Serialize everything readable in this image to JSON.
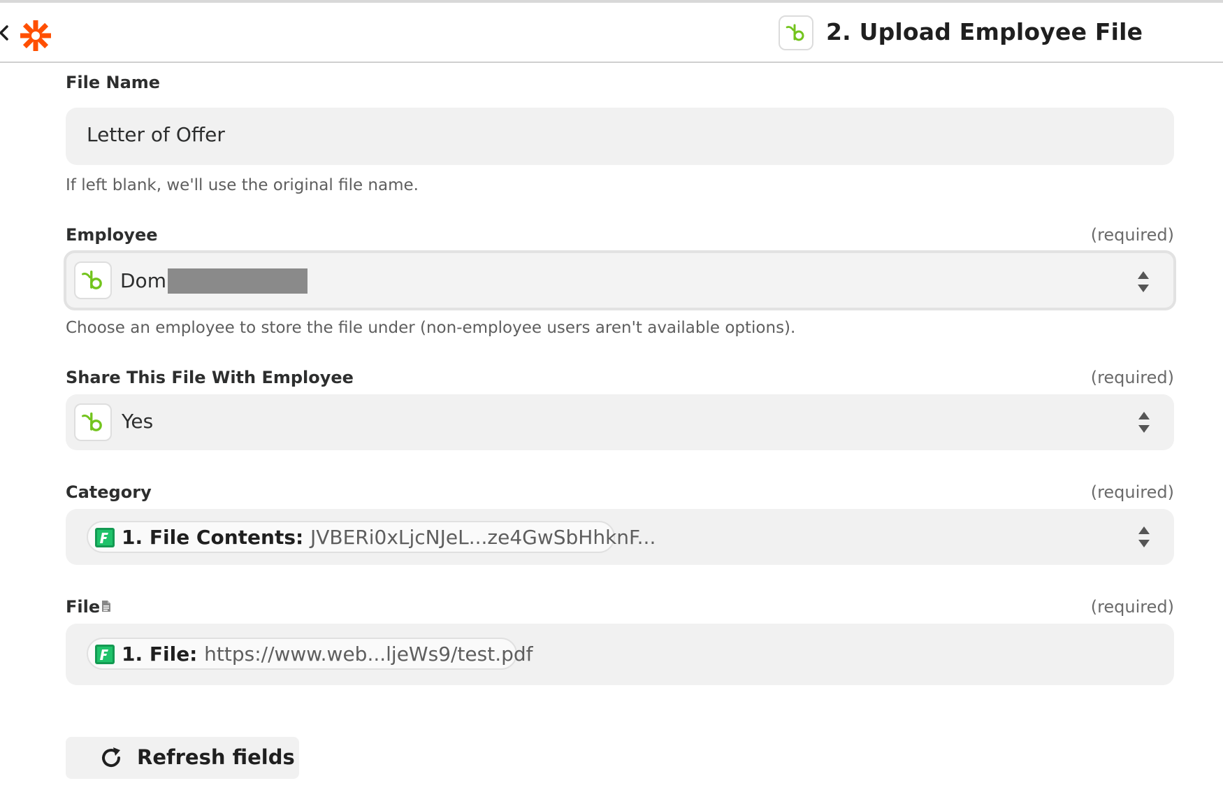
{
  "header": {
    "step_title": "2. Upload Employee File",
    "back_icon": "chevron-left-icon",
    "logo_icon": "zapier-asterisk-icon",
    "app_icon": "bamboohr-icon"
  },
  "colors": {
    "zapier_orange": "#ff4f00",
    "bamboo_green": "#73c41d",
    "field_bg": "#f1f1f1"
  },
  "fields": {
    "file_name": {
      "label": "File Name",
      "value": "Letter of Offer",
      "hint": "If left blank, we'll use the original file name."
    },
    "employee": {
      "label": "Employee",
      "required": "(required)",
      "value": "Dom",
      "hint": "Choose an employee to store the file under (non-employee users aren't available options)."
    },
    "share": {
      "label": "Share This File With Employee",
      "required": "(required)",
      "value": "Yes"
    },
    "category": {
      "label": "Category",
      "required": "(required)",
      "pill_key": "1. File Contents:",
      "pill_value": "JVBERi0xLjcNJeL...ze4GwSbHhknF..."
    },
    "file": {
      "label": "File",
      "required": "(required)",
      "pill_key": "1. File:",
      "pill_value": "https://www.web...ljeWs9/test.pdf"
    }
  },
  "refresh": {
    "label": "Refresh fields"
  }
}
